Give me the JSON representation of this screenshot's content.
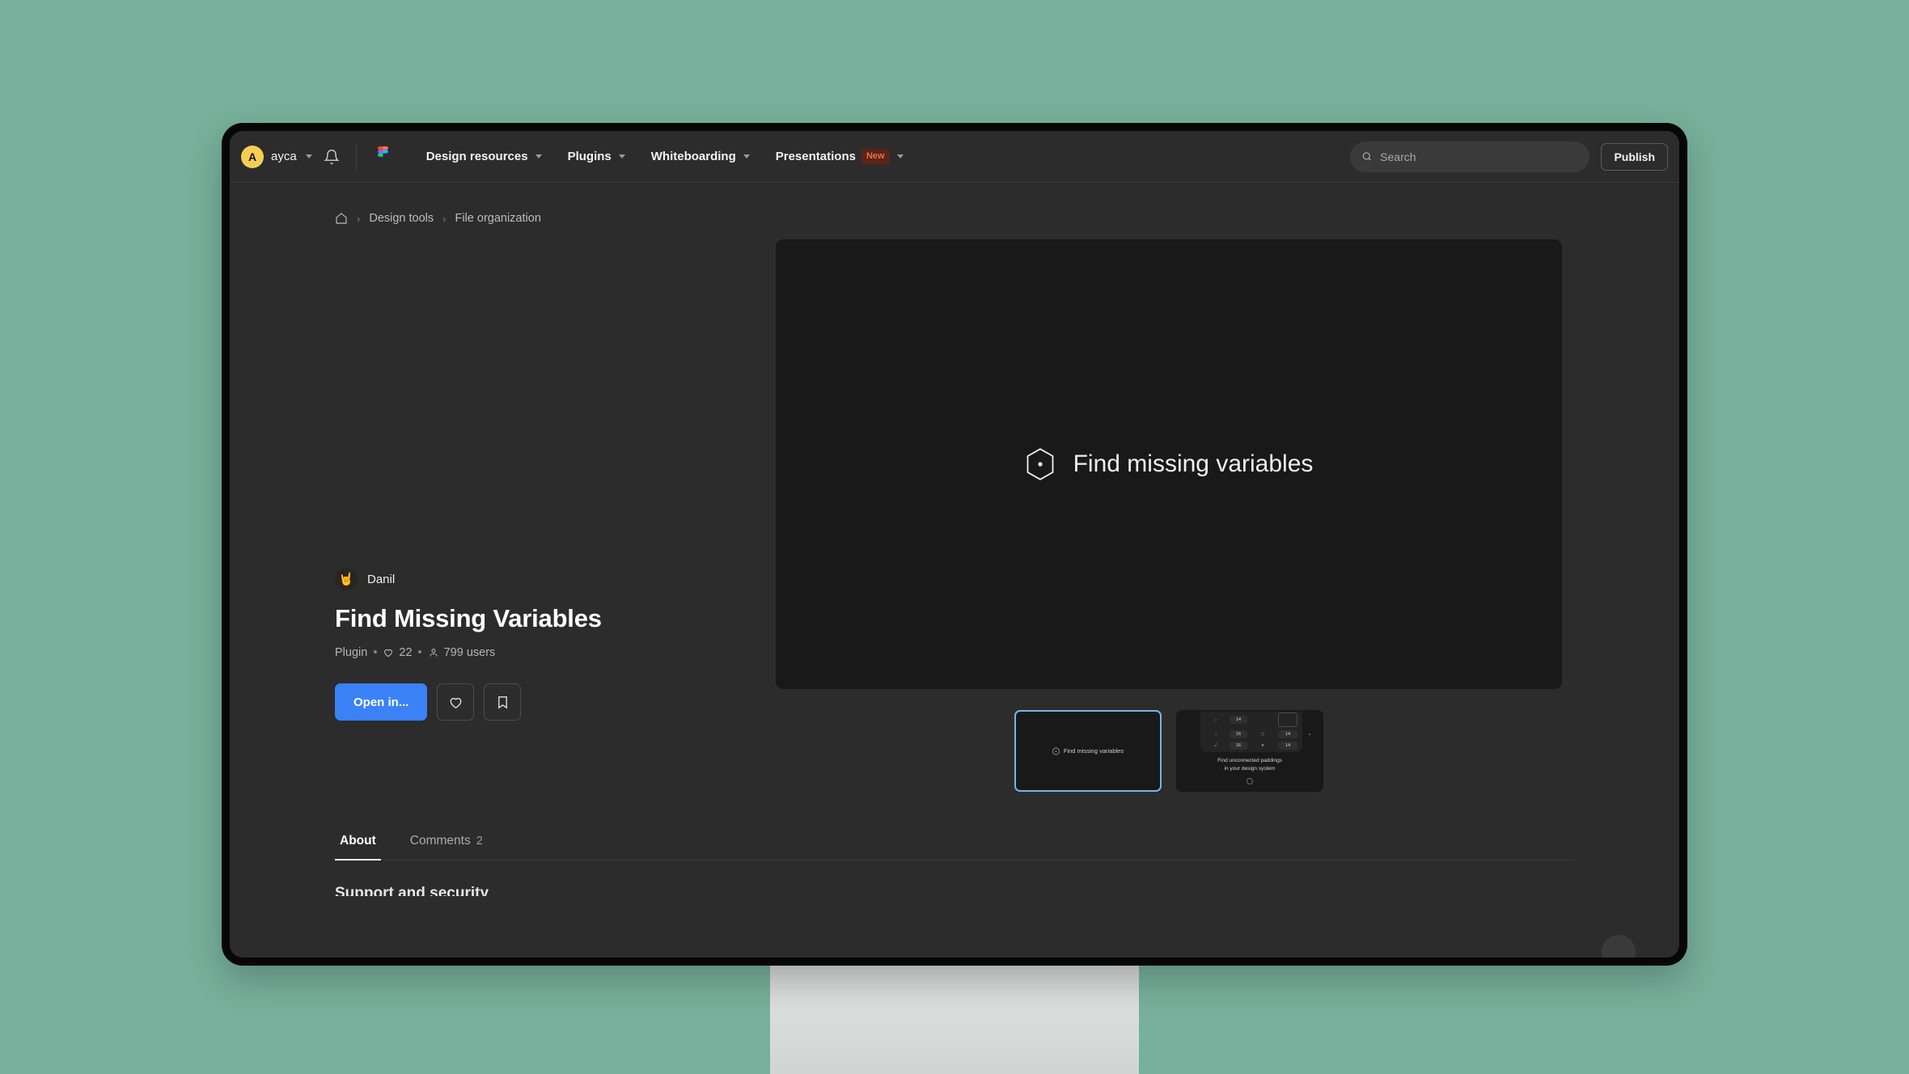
{
  "theme": {
    "wall_color": "#77b09c",
    "bezel_color": "#070707",
    "page_bg": "#2c2c2c",
    "panel_bg": "#191919",
    "accent_blue": "#3b82f6",
    "selected_border": "#7cb3e8",
    "badge_bg": "#5b2418",
    "badge_text": "#f06c4b",
    "avatar_bg": "#f5cf53"
  },
  "topnav": {
    "account": {
      "initial": "A",
      "name": "ayca"
    },
    "bell_icon": "bell-icon",
    "logo_icon": "figma-logo-icon",
    "menu": [
      {
        "label": "Design resources",
        "has_chevron": true,
        "badge": null
      },
      {
        "label": "Plugins",
        "has_chevron": true,
        "badge": null
      },
      {
        "label": "Whiteboarding",
        "has_chevron": true,
        "badge": null
      },
      {
        "label": "Presentations",
        "has_chevron": true,
        "badge": "New"
      }
    ],
    "search": {
      "placeholder": "Search",
      "value": "",
      "icon": "search-icon"
    },
    "publish_label": "Publish"
  },
  "breadcrumb": {
    "home_icon": "home-icon",
    "separator": "›",
    "items": [
      {
        "label": "Design tools"
      },
      {
        "label": "File organization"
      }
    ]
  },
  "detail": {
    "author": {
      "name": "Danil",
      "avatar_emoji": "🤘"
    },
    "title": "Find Missing Variables",
    "meta": {
      "type": "Plugin",
      "dot": "•",
      "likes": "22",
      "likes_icon": "heart-icon",
      "users": "799 users",
      "users_icon": "person-icon"
    },
    "actions": {
      "primary_label": "Open in...",
      "like_icon": "heart-icon",
      "save_icon": "bookmark-icon"
    }
  },
  "hero": {
    "icon": "hexagon-dot-icon",
    "label": "Find missing variables"
  },
  "thumbnails": [
    {
      "selected": true,
      "kind": "label",
      "icon": "hexagon-dot-icon",
      "label": "Find missing variables"
    },
    {
      "selected": false,
      "kind": "mock",
      "caption_line1": "Find unconnected paddings",
      "caption_line2": "in your design system",
      "chips": [
        "14",
        "16",
        "16",
        "14",
        "14"
      ],
      "chip_icons": [
        "↔",
        "↕",
        "⤦",
        "▽",
        "⚬"
      ],
      "footer_icon": "hexagon-dot-icon"
    }
  ],
  "tabs": [
    {
      "label": "About",
      "count": null,
      "active": true
    },
    {
      "label": "Comments",
      "count": "2",
      "active": false
    }
  ],
  "below_tabs": {
    "heading": "Support and security"
  },
  "fab": {
    "icon": "help-icon"
  }
}
